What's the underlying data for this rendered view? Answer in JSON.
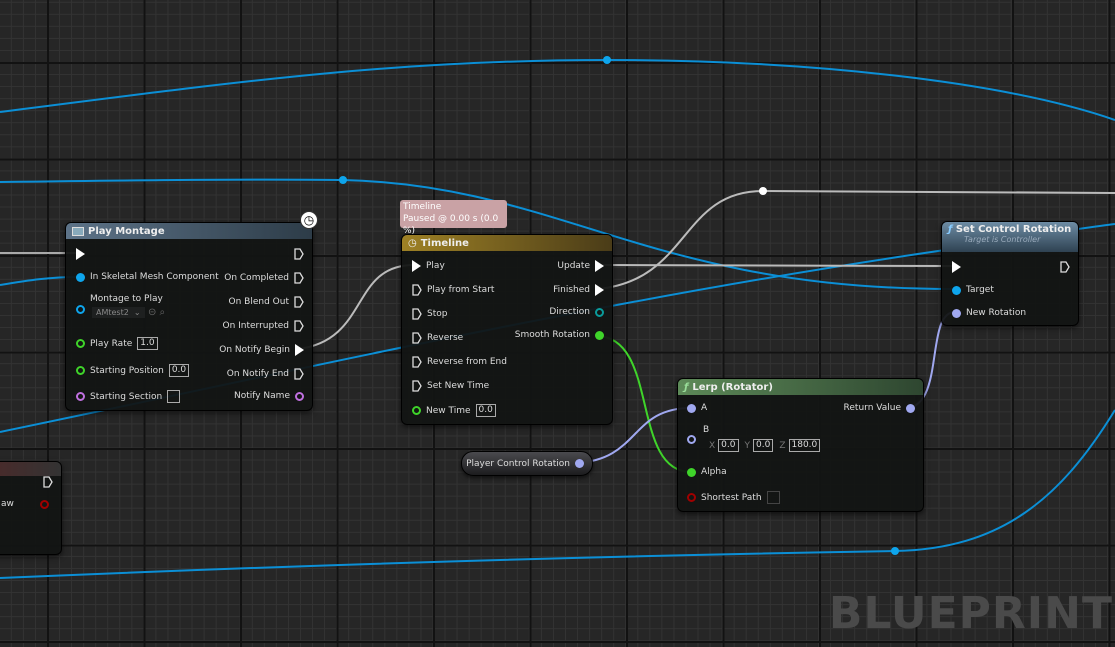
{
  "colors": {
    "exec": "#ffffff",
    "object": "#0ea5ec",
    "float": "#3fd42a",
    "rotator": "#a0a8f0",
    "name": "#c070e0",
    "bool": "#a00000",
    "struct_dir": "#0a9b9b"
  },
  "play_montage": {
    "title": "Play Montage",
    "pins_in": [
      "In Skeletal Mesh Component",
      "Montage to Play",
      "Play Rate",
      "Starting Position",
      "Starting Section"
    ],
    "montage_value": "AMtest2",
    "play_rate": "1.0",
    "starting_position": "0.0",
    "pins_out": [
      "On Completed",
      "On Blend Out",
      "On Interrupted",
      "On Notify Begin",
      "On Notify End",
      "Notify Name"
    ]
  },
  "timeline": {
    "tooltip_title": "Timeline",
    "tooltip_status": "Paused @ 0.00 s (0.0 %)",
    "title": "Timeline",
    "pins_in": [
      "Play",
      "Play from Start",
      "Stop",
      "Reverse",
      "Reverse from End",
      "Set New Time",
      "New Time"
    ],
    "new_time": "0.0",
    "pins_out": [
      "Update",
      "Finished",
      "Direction",
      "Smooth Rotation"
    ]
  },
  "set_control_rotation": {
    "title": "Set Control Rotation",
    "subtitle": "Target is Controller",
    "pins_in": [
      "Target",
      "New Rotation"
    ]
  },
  "lerp": {
    "title": "Lerp (Rotator)",
    "pins_in": [
      "A",
      "B",
      "Alpha",
      "Shortest Path"
    ],
    "b": {
      "x_label": "X",
      "x": "0.0",
      "y_label": "Y",
      "y": "0.0",
      "z_label": "Z",
      "z": "180.0"
    },
    "pins_out": [
      "Return Value"
    ]
  },
  "player_control_rotation": {
    "label": "Player Control Rotation"
  },
  "partial_node": {
    "pin_label": "aw"
  },
  "watermark": "BLUEPRINT"
}
